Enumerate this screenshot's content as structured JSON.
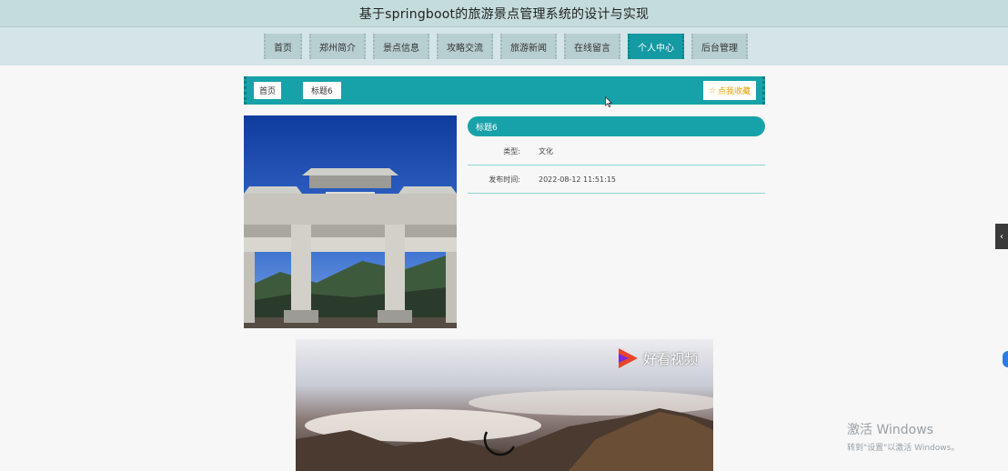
{
  "header": {
    "title": "基于springboot的旅游景点管理系统的设计与实现"
  },
  "nav": {
    "items": [
      {
        "label": "首页",
        "active": false
      },
      {
        "label": "郑州简介",
        "active": false
      },
      {
        "label": "景点信息",
        "active": false
      },
      {
        "label": "攻略交流",
        "active": false
      },
      {
        "label": "旅游新闻",
        "active": false
      },
      {
        "label": "在线留言",
        "active": false
      },
      {
        "label": "个人中心",
        "active": true
      },
      {
        "label": "后台管理",
        "active": false
      }
    ],
    "accent_color": "#139aa3"
  },
  "breadcrumb": {
    "home": "首页",
    "current": "标题6"
  },
  "favorite": {
    "label": "点我收藏",
    "icon": "star-outline-icon"
  },
  "detail": {
    "title": "标题6",
    "type_label": "类型:",
    "type_value": "文化",
    "time_label": "发布时间:",
    "time_value": "2022-08-12 11:51:15"
  },
  "video": {
    "brand_text": "好看视频",
    "brand_icon": "play-logo-icon"
  },
  "side_tab": {
    "icon": "chevron-left-icon"
  },
  "watermark": {
    "line1": "激活 Windows",
    "line2": "转到\"设置\"以激活 Windows。"
  }
}
